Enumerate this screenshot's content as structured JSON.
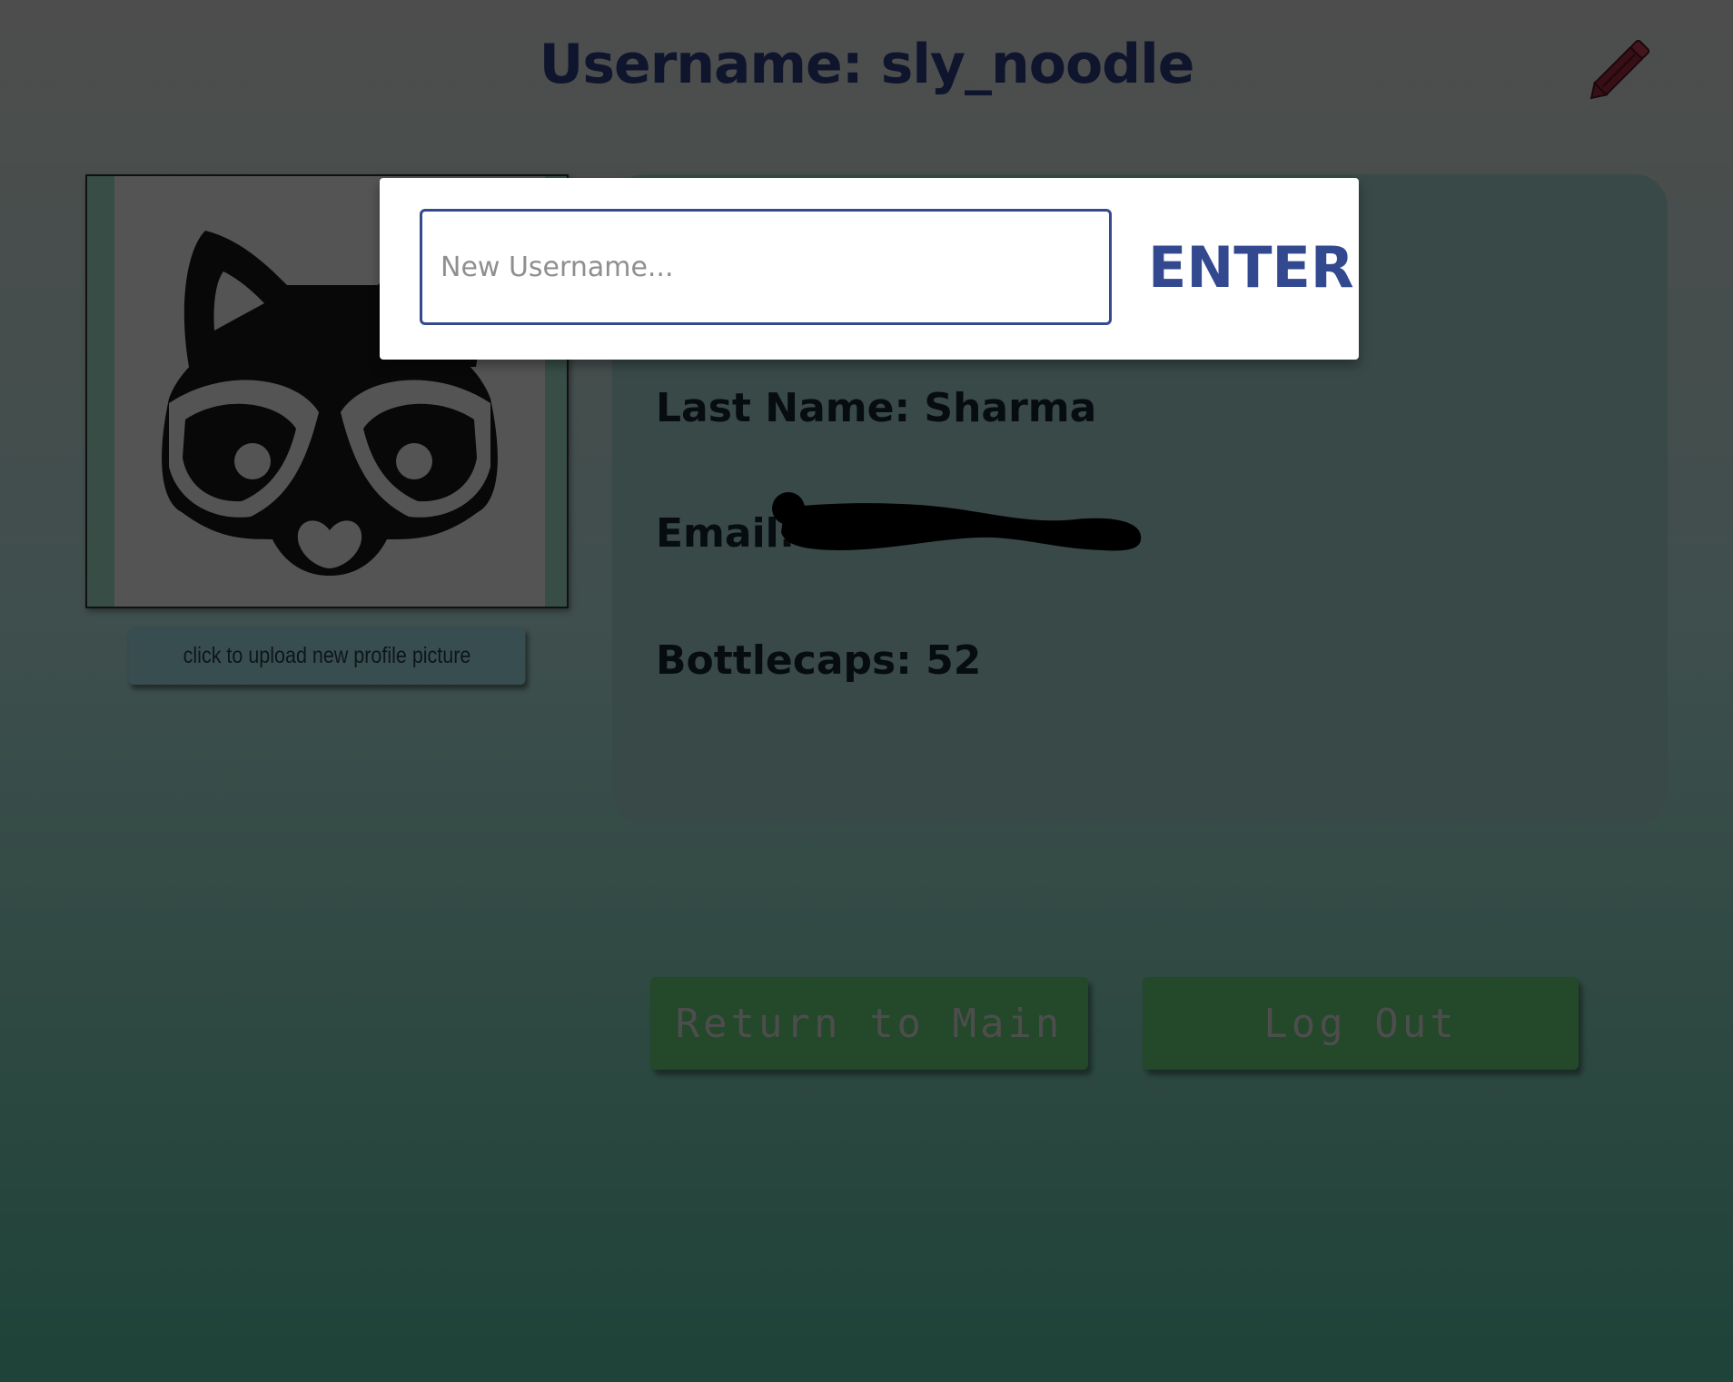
{
  "header": {
    "title": "Username: sly_noodle",
    "edit_icon": "pencil-icon",
    "edit_icon_color": "#6e1f2c"
  },
  "profile": {
    "avatar_icon": "raccoon-avatar",
    "upload_label": "click to upload new profile picture"
  },
  "info": {
    "last_name": "Last Name: Sharma",
    "email_label": "Email:",
    "bottlecaps": "Bottlecaps: 52"
  },
  "actions": {
    "return_label": "Return to Main",
    "logout_label": "Log Out"
  },
  "modal": {
    "input_placeholder": "New Username...",
    "input_value": "",
    "enter_label": "ENTER"
  },
  "colors": {
    "accent": "#33498f",
    "button_green": "#469155",
    "title_color": "#1f2a5a"
  }
}
